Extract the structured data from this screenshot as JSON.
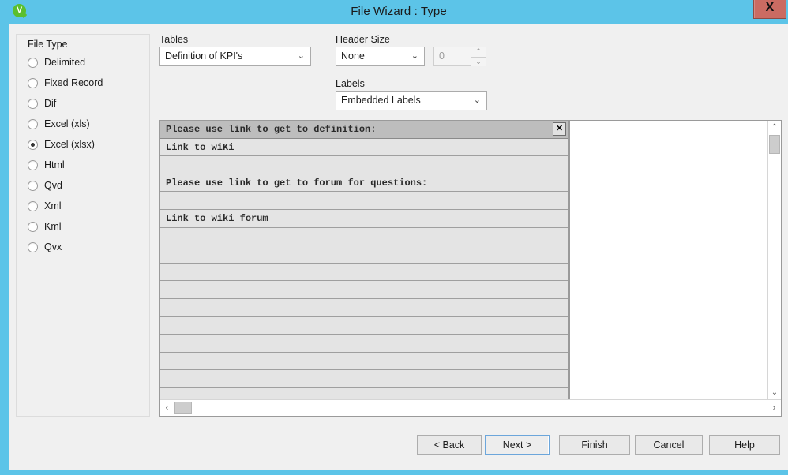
{
  "window": {
    "title": "File Wizard : Type",
    "app_icon": "qlikview-logo-icon",
    "icon_letter": "V",
    "close_label": "X",
    "accent_color": "#5CC4E8",
    "background_color": "#F0F0F0",
    "close_button_color": "#CB6B62"
  },
  "file_type": {
    "group_title": "File Type",
    "options": [
      {
        "label": "Delimited",
        "selected": false
      },
      {
        "label": "Fixed Record",
        "selected": false
      },
      {
        "label": "Dif",
        "selected": false
      },
      {
        "label": "Excel (xls)",
        "selected": false
      },
      {
        "label": "Excel (xlsx)",
        "selected": true
      },
      {
        "label": "Html",
        "selected": false
      },
      {
        "label": "Qvd",
        "selected": false
      },
      {
        "label": "Xml",
        "selected": false
      },
      {
        "label": "Kml",
        "selected": false
      },
      {
        "label": "Qvx",
        "selected": false
      }
    ],
    "selected_value": "Excel (xlsx)"
  },
  "tables": {
    "label": "Tables",
    "value": "Definition of KPI's",
    "chevron": "⌄"
  },
  "header_size": {
    "label": "Header Size",
    "value": "None",
    "chevron": "⌄",
    "spinner_value": "0",
    "spinner_up": "⌃",
    "spinner_down": "⌄",
    "spinner_disabled": true
  },
  "labels_field": {
    "label": "Labels",
    "value": "Embedded Labels",
    "chevron": "⌄"
  },
  "preview": {
    "column_close_label": "✕",
    "rows": [
      {
        "text": "Please use link to get to definition:",
        "header": true
      },
      {
        "text": "Link to wiKi",
        "header": false
      },
      {
        "text": "",
        "header": false
      },
      {
        "text": "Please use link to get to forum for questions:",
        "header": false
      },
      {
        "text": "",
        "header": false
      },
      {
        "text": "Link to wiki forum",
        "header": false
      },
      {
        "text": "",
        "header": false
      },
      {
        "text": "",
        "header": false
      },
      {
        "text": "",
        "header": false
      },
      {
        "text": "",
        "header": false
      },
      {
        "text": "",
        "header": false
      },
      {
        "text": "",
        "header": false
      },
      {
        "text": "",
        "header": false
      },
      {
        "text": "",
        "header": false
      },
      {
        "text": "",
        "header": false
      },
      {
        "text": "",
        "header": false
      }
    ],
    "vscroll": {
      "up_arrow": "⌃",
      "down_arrow": "⌄"
    },
    "hscroll": {
      "left_arrow": "‹",
      "right_arrow": "›"
    }
  },
  "footer": {
    "buttons": [
      {
        "label": "< Back",
        "default": false
      },
      {
        "label": "Next >",
        "default": true
      },
      {
        "label": "Finish",
        "default": false
      },
      {
        "label": "Cancel",
        "default": false
      },
      {
        "label": "Help",
        "default": false
      }
    ]
  }
}
